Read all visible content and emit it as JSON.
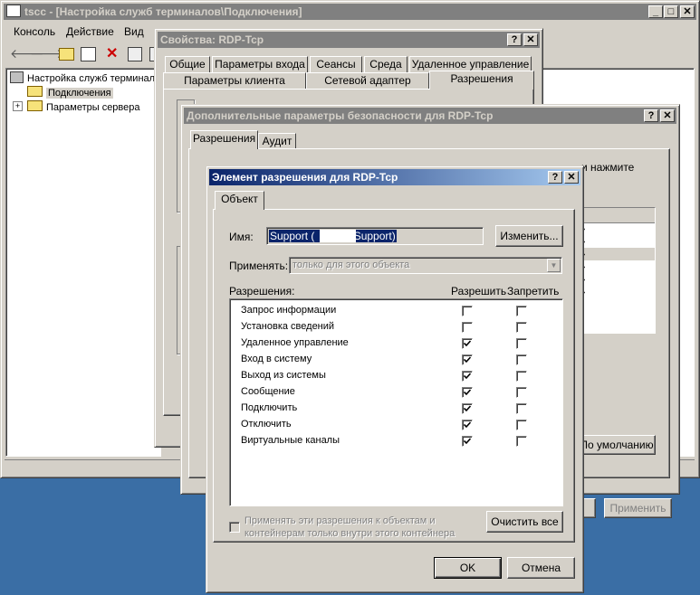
{
  "main_window": {
    "title": "tscc - [Настройка служб терминалов\\Подключения]",
    "menu": [
      "Консоль",
      "Действие",
      "Вид"
    ],
    "tree": {
      "root": "Настройка служб терминалов",
      "connections": "Подключения",
      "server_settings": "Параметры сервера"
    }
  },
  "props_dialog": {
    "title": "Свойства: RDP-Tcp",
    "tabs_row1": [
      "Общие",
      "Параметры входа",
      "Сеансы",
      "Среда",
      "Удаленное управление"
    ],
    "tabs_row2": [
      "Параметры клиента",
      "Сетевой адаптер",
      "Разрешения"
    ],
    "apply_button": "Применить"
  },
  "advanced_dialog": {
    "title": "Дополнительные параметры безопасности для RDP-Tcp",
    "tabs": [
      "Разрешения",
      "Аудит"
    ],
    "hint_fragment": "и нажмите",
    "default_button": "По умолчанию"
  },
  "entry_dialog": {
    "title": "Элемент разрешения для RDP-Tcp",
    "tab": "Объект",
    "name_label": "Имя:",
    "name_value": "Support (            \\Support)",
    "change_button": "Изменить...",
    "apply_to_label": "Применять:",
    "apply_to_value": "только для этого объекта",
    "permissions_label": "Разрешения:",
    "allow_header": "Разрешить",
    "deny_header": "Запретить",
    "permissions": [
      {
        "name": "Запрос информации",
        "allow": false,
        "deny": false
      },
      {
        "name": "Установка сведений",
        "allow": false,
        "deny": false
      },
      {
        "name": "Удаленное управление",
        "allow": true,
        "deny": false
      },
      {
        "name": "Вход в систему",
        "allow": true,
        "deny": false
      },
      {
        "name": "Выход из системы",
        "allow": true,
        "deny": false
      },
      {
        "name": "Сообщение",
        "allow": true,
        "deny": false
      },
      {
        "name": "Подключить",
        "allow": true,
        "deny": false
      },
      {
        "name": "Отключить",
        "allow": true,
        "deny": false
      },
      {
        "name": "Виртуальные каналы",
        "allow": true,
        "deny": false
      }
    ],
    "inherit_line1": "Применять эти разрешения к объектам и",
    "inherit_line2": "контейнерам только внутри этого контейнера",
    "clear_all_button": "Очистить все",
    "ok_button": "OK",
    "cancel_button": "Отмена"
  }
}
